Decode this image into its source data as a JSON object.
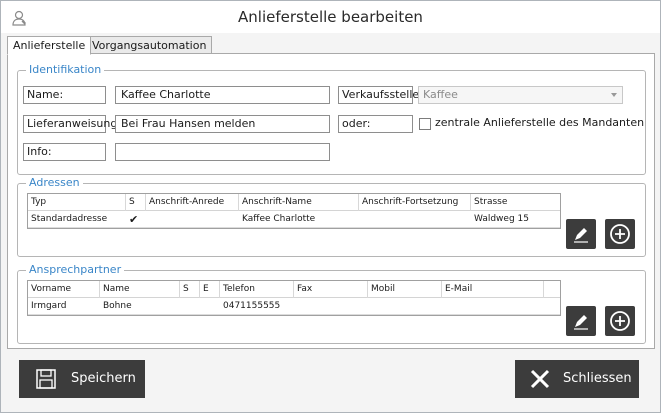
{
  "window": {
    "title": "Anlieferstelle bearbeiten"
  },
  "tabs": [
    {
      "label": "Anlieferstelle",
      "active": true
    },
    {
      "label": "Vorgangsautomation",
      "active": false
    }
  ],
  "identifikation": {
    "title": "Identifikation",
    "name_label": "Name:",
    "name_value": "Kaffee Charlotte",
    "lieferanweisung_label": "Lieferanweisung:",
    "lieferanweisung_value": "Bei Frau Hansen melden",
    "info_label": "Info:",
    "info_value": "",
    "verkaufsstelle_label": "Verkaufsstelle:",
    "verkaufsstelle_value": "Kaffee",
    "oder_label": "oder:",
    "zentrale_label": "zentrale Anlieferstelle des Mandanten",
    "zentrale_checked": false
  },
  "adressen": {
    "title": "Adressen",
    "columns": [
      "Typ",
      "S",
      "Anschrift-Anrede",
      "Anschrift-Name",
      "Anschrift-Fortsetzung",
      "Strasse"
    ],
    "rows": [
      {
        "typ": "Standardadresse",
        "s": "✔",
        "anrede": "",
        "name": "Kaffee Charlotte",
        "fortsetzung": "",
        "strasse": "Waldweg 15"
      }
    ]
  },
  "ansprechpartner": {
    "title": "Ansprechpartner",
    "columns": [
      "Vorname",
      "Name",
      "S",
      "E",
      "Telefon",
      "Fax",
      "Mobil",
      "E-Mail"
    ],
    "rows": [
      {
        "vorname": "Irmgard",
        "name": "Bohne",
        "s": "",
        "e": "",
        "telefon": "0471155555",
        "fax": "",
        "mobil": "",
        "email": ""
      }
    ]
  },
  "footer": {
    "save_label": "Speichern",
    "close_label": "Schliessen"
  },
  "colors": {
    "accent": "#3a86c8",
    "button_dark": "#3c3c3c",
    "border": "#a9a9a9"
  },
  "icons": {
    "title": "user-icon",
    "edit": "pencil-icon",
    "add": "plus-circle-icon",
    "save": "floppy-disk-icon",
    "close": "close-x-icon"
  }
}
